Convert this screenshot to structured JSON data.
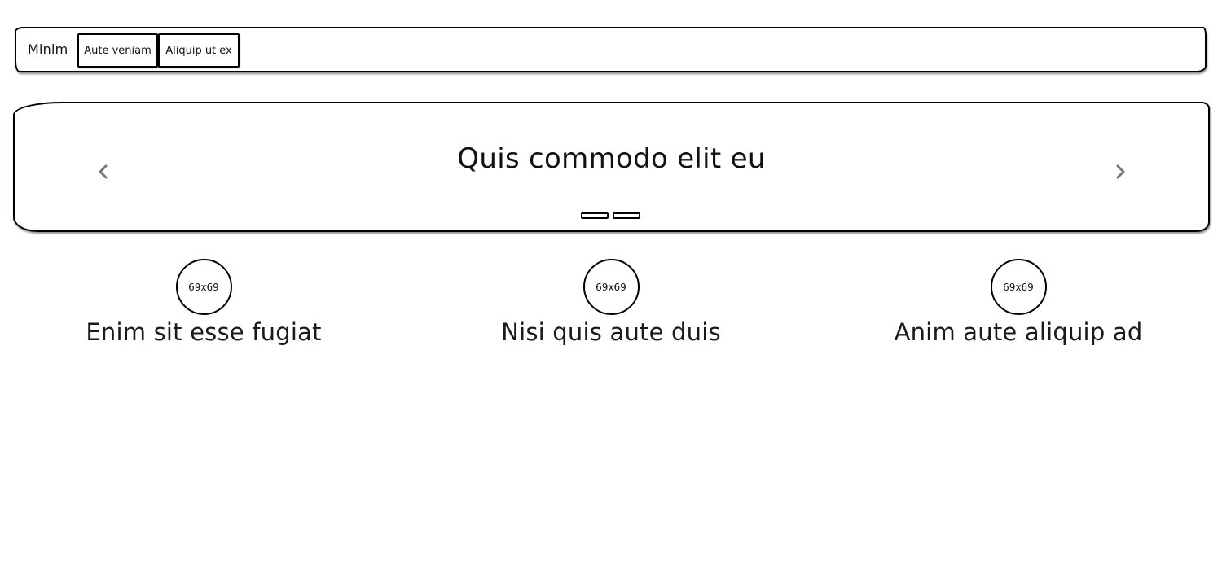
{
  "navbar": {
    "brand": "Minim",
    "buttons": [
      "Aute veniam",
      "Aliquip ut ex"
    ]
  },
  "carousel": {
    "title": "Quis commodo elit eu",
    "prev_icon": "chevron-left-icon",
    "next_icon": "chevron-right-icon",
    "indicator_count": 2,
    "arrow_color": "#777777"
  },
  "features": [
    {
      "image_label": "69x69",
      "title": "Enim sit esse fugiat"
    },
    {
      "image_label": "69x69",
      "title": "Nisi quis aute duis"
    },
    {
      "image_label": "69x69",
      "title": "Anim aute aliquip ad"
    }
  ]
}
